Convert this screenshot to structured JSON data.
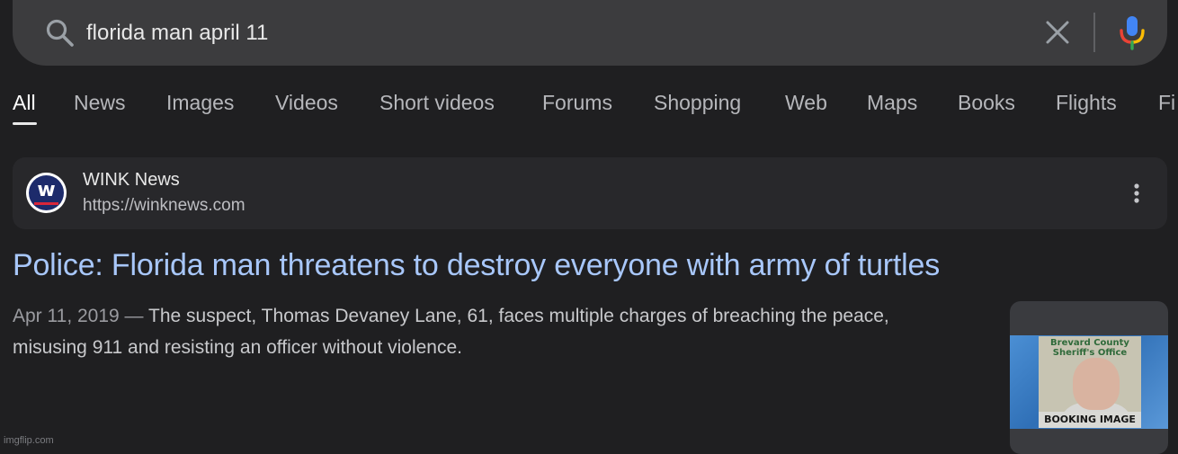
{
  "search": {
    "query": "florida man april 11"
  },
  "tabs": [
    {
      "label": "All",
      "active": true
    },
    {
      "label": "News"
    },
    {
      "label": "Images"
    },
    {
      "label": "Videos"
    },
    {
      "label": "Short videos"
    },
    {
      "label": "Forums"
    },
    {
      "label": "Shopping"
    },
    {
      "label": "Web"
    },
    {
      "label": "Maps"
    },
    {
      "label": "Books"
    },
    {
      "label": "Flights"
    },
    {
      "label": "Fi"
    }
  ],
  "result": {
    "source_name": "WINK News",
    "source_url": "https://winknews.com",
    "favicon_letter": "w",
    "title": "Police: Florida man threatens to destroy everyone with army of turtles",
    "date": "Apr 11, 2019",
    "separator": " — ",
    "snippet": "The suspect, Thomas Devaney Lane, 61, faces multiple charges of breaching the peace, misusing 911 and resisting an officer without violence.",
    "thumbnail": {
      "header_line1": "Brevard County",
      "header_line2": "Sheriff's Office",
      "caption": "BOOKING IMAGE"
    }
  },
  "watermark": "imgflip.com",
  "colors": {
    "background": "#1f1f21",
    "searchbar": "#3c3c3e",
    "link": "#a8c7fa",
    "card": "#28282b"
  },
  "icons": [
    "search-icon",
    "clear-icon",
    "mic-icon",
    "more-vert-icon"
  ]
}
